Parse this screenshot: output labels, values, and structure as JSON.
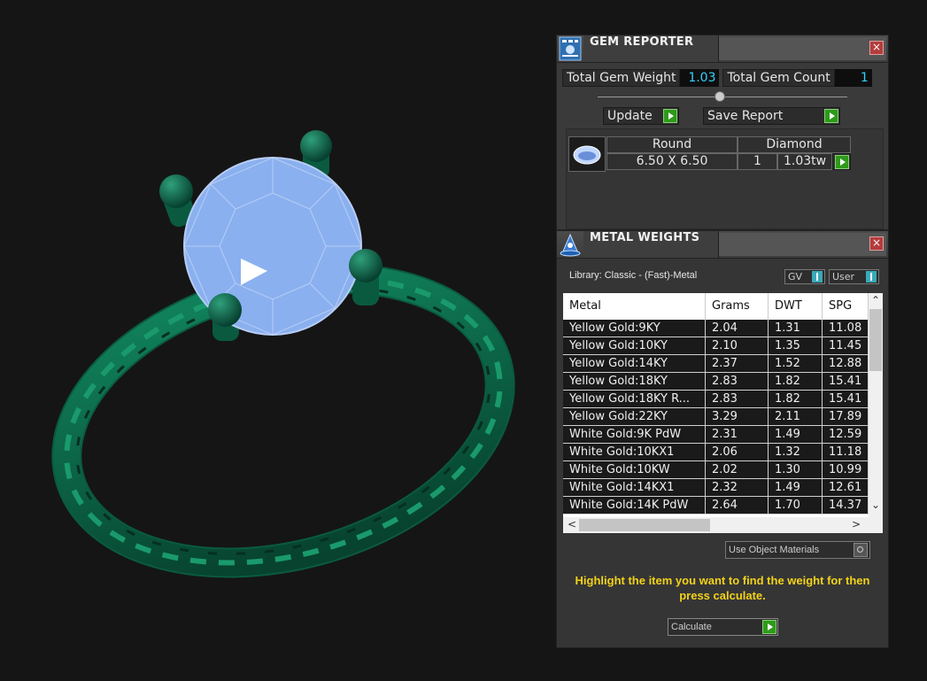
{
  "gem_reporter": {
    "title": "GEM REPORTER",
    "close": "×",
    "total_gem_weight_label": "Total Gem Weight",
    "total_gem_weight_value": "1.03",
    "total_gem_count_label": "Total Gem Count",
    "total_gem_count_value": "1",
    "update_label": "Update",
    "save_report_label": "Save Report",
    "gem": {
      "shape": "Round",
      "type": "Diamond",
      "size": "6.50 X 6.50",
      "count": "1",
      "weight": "1.03tw"
    }
  },
  "metal_weights": {
    "title": "METAL WEIGHTS",
    "close": "×",
    "library": "Library: Classic - (Fast)-Metal",
    "gv_label": "GV",
    "user_label": "User",
    "columns": [
      "Metal",
      "Grams",
      "DWT",
      "SPG"
    ],
    "rows": [
      [
        "Yellow Gold:9KY",
        "2.04",
        "1.31",
        "11.08"
      ],
      [
        "Yellow Gold:10KY",
        "2.10",
        "1.35",
        "11.45"
      ],
      [
        "Yellow Gold:14KY",
        "2.37",
        "1.52",
        "12.88"
      ],
      [
        "Yellow Gold:18KY",
        "2.83",
        "1.82",
        "15.41"
      ],
      [
        "Yellow Gold:18KY R...",
        "2.83",
        "1.82",
        "15.41"
      ],
      [
        "Yellow Gold:22KY",
        "3.29",
        "2.11",
        "17.89"
      ],
      [
        "White Gold:9K PdW",
        "2.31",
        "1.49",
        "12.59"
      ],
      [
        "White Gold:10KX1",
        "2.06",
        "1.32",
        "11.18"
      ],
      [
        "White Gold:10KW",
        "2.02",
        "1.30",
        "10.99"
      ],
      [
        "White Gold:14KX1",
        "2.32",
        "1.49",
        "12.61"
      ],
      [
        "White Gold:14K PdW",
        "2.64",
        "1.70",
        "14.37"
      ]
    ],
    "use_object_materials": "Use Object Materials",
    "hint": "Highlight the item you want to find the weight for then press calculate.",
    "calculate_label": "Calculate"
  },
  "colors": {
    "ring": "#0d6a4c",
    "gem": "#8ab0ef",
    "accent_value": "#35d0ff",
    "hint": "#f2d21a",
    "play_button": "#2e9a1a"
  }
}
